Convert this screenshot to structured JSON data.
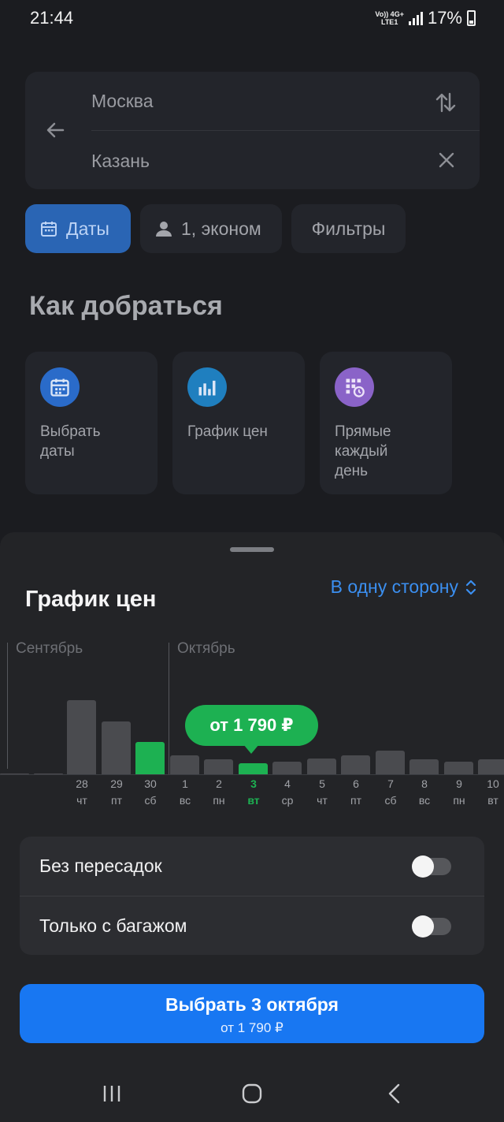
{
  "status_bar": {
    "time": "21:44",
    "network_top": "Vo)) 4G+",
    "network_bottom": "LTE1",
    "battery": "17%"
  },
  "route": {
    "from": "Москва",
    "to": "Казань",
    "back_icon": "arrow-left-icon",
    "swap_icon": "swap-vertical-icon",
    "clear_icon": "close-icon"
  },
  "chips": {
    "dates": "Даты",
    "passengers": "1, эконом",
    "filters": "Фильтры"
  },
  "section_title": "Как добраться",
  "tiles": [
    {
      "label": "Выбрать\nдаты",
      "icon": "calendar-icon",
      "color": "#2a6bc9"
    },
    {
      "label": "График цен",
      "icon": "bar-chart-icon",
      "color": "#1f7fbf"
    },
    {
      "label": "Прямые\nкаждый\nдень",
      "icon": "calendar-clock-icon",
      "color": "#8a63c8"
    }
  ],
  "sheet": {
    "title": "График цен",
    "direction": "В одну сторону"
  },
  "chart_data": {
    "type": "bar",
    "months": [
      "Сентябрь",
      "Октябрь"
    ],
    "categories": [
      "28",
      "29",
      "30",
      "1",
      "2",
      "3",
      "4",
      "5",
      "6",
      "7",
      "8",
      "9",
      "10"
    ],
    "weekdays": [
      "чт",
      "пт",
      "сб",
      "вс",
      "пн",
      "вт",
      "ср",
      "чт",
      "пт",
      "сб",
      "вс",
      "пн",
      "вт"
    ],
    "values": [
      0.98,
      0.7,
      0.43,
      0.25,
      0.2,
      0.15,
      0.17,
      0.21,
      0.25,
      0.31,
      0.2,
      0.17,
      0.2
    ],
    "highlighted": [
      2,
      5
    ],
    "selected_index": 5,
    "tooltip": "от 1 790 ₽",
    "colors": {
      "bar": "#4a4b4f",
      "highlight": "#1db152"
    }
  },
  "filters": {
    "nonstop": {
      "label": "Без пересадок",
      "on": false
    },
    "baggage": {
      "label": "Только с багажом",
      "on": false
    }
  },
  "cta": {
    "title": "Выбрать 3 октября",
    "subtitle": "от 1 790 ₽"
  },
  "navbar": {
    "recent": "recent-apps-icon",
    "home": "home-icon",
    "back": "back-icon"
  }
}
